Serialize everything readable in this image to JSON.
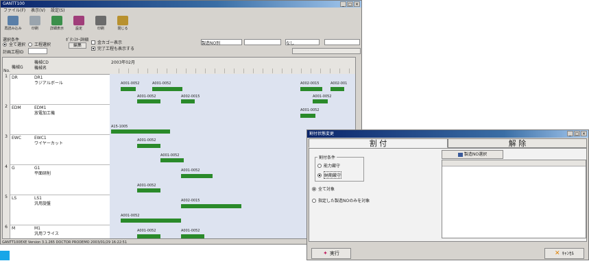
{
  "main_window": {
    "title": "GANTT100",
    "menu": [
      "ファイル(F)",
      "表示(V)",
      "設定(S)"
    ],
    "toolbar": [
      "再読み込み",
      "印刷",
      "詳細表示",
      "設定",
      "印刷",
      "閉じる"
    ],
    "options": {
      "condition_label": "選択条件",
      "radio_all": "全て選択",
      "radio_process": "工程選択",
      "work_process_label": "計画工程ID",
      "display_label": "ﾎﾞﾀﾝｽｷｰ詳細",
      "edit_button": "編集",
      "check_kanban": "金カゴー表示",
      "check_done": "完了工程も表示する",
      "seizo_label": "製造NO別",
      "nashi": "なし",
      "month": "2003年02月"
    },
    "header": {
      "col1": "機械G",
      "col2a": "機械CD",
      "col2b": "機械名",
      "no": "No."
    },
    "rows": [
      {
        "no": "1",
        "code": "DR",
        "cd": "DR1",
        "name": "ラジアルボール"
      },
      {
        "no": "2",
        "code": "EDM",
        "cd": "EDM1",
        "name": "放電加工機"
      },
      {
        "no": "3",
        "code": "EWC",
        "cd": "EWC1",
        "name": "ワイヤーカット"
      },
      {
        "no": "4",
        "code": "G",
        "cd": "G1",
        "name": "平面研削"
      },
      {
        "no": "5",
        "code": "LS",
        "cd": "LS1",
        "name": "汎用旋盤"
      },
      {
        "no": "6",
        "code": "M",
        "cd": "M1",
        "name": "汎用フライス"
      }
    ],
    "jobs": {
      "a1": "A001-0052",
      "a2": "A001-0052",
      "a3": "A002-0015",
      "a4": "A002-001",
      "a5": "A001-0052",
      "a6": "A002-0015",
      "a7": "A001-0052",
      "a8": "A001-0052",
      "a9": "A15-1005",
      "a10": "A001-0052",
      "a11": "A001-0052",
      "a12": "A001-0052",
      "a13": "A001-0052",
      "a14": "A002-0015",
      "a15": "A001-0052",
      "a16": "A001-0052",
      "a17": "A001-0052"
    },
    "status": "GANTT100EXE     Version 3.1.265   DOCTOR   PRODEMO     2003/01/29 16:22:51"
  },
  "dialog": {
    "title": "割付状態変更",
    "tab_assign": "割 付",
    "tab_release": "解 除",
    "cond_label": "割付条件",
    "radio_capacity": "能力厳守",
    "radio_deadline": "納期厳守",
    "radio_all": "全て対象",
    "radio_selected": "指定した製造NOのみを対象",
    "select_button": "製造NO選択",
    "run_button": "実行",
    "cancel_button": "ｷｬﾝｾﾙ"
  },
  "colors": {
    "bar": "#2a8a2a",
    "title": "#0a246a",
    "accent": "#17a6e8"
  }
}
